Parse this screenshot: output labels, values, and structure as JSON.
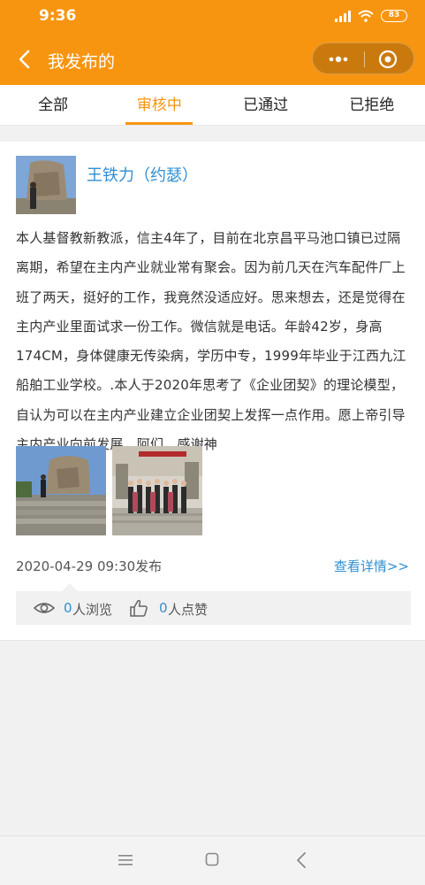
{
  "status_bar": {
    "time": "9:36",
    "battery": "83"
  },
  "nav": {
    "title": "我发布的"
  },
  "tabs": [
    {
      "label": "全部",
      "active": false
    },
    {
      "label": "审核中",
      "active": true
    },
    {
      "label": "已通过",
      "active": false
    },
    {
      "label": "已拒绝",
      "active": false
    }
  ],
  "post": {
    "author": "王铁力（约瑟）",
    "text": "本人基督教新教派，信主4年了，目前在北京昌平马池口镇已过隔离期，希望在主内产业就业常有聚会。因为前几天在汽车配件厂上班了两天，挺好的工作，我竟然没适应好。思来想去，还是觉得在主内产业里面试求一份工作。微信就是电话。年龄42岁，身高174CM，身体健康无传染病，学历中专，1999年毕业于江西九江船舶工业学校。.本人于2020年思考了《企业团契》的理论模型，自认为可以在主内产业建立企业团契上发挥一点作用。愿上帝引导主内产业向前发展，阿们，感谢神",
    "date": "2020-04-29 09:30发布",
    "detail_link": "查看详情>>",
    "views": "0",
    "views_label": "人浏览",
    "likes": "0",
    "likes_label": "人点赞"
  },
  "colors": {
    "accent": "#f79511",
    "link": "#2f8fd1"
  }
}
